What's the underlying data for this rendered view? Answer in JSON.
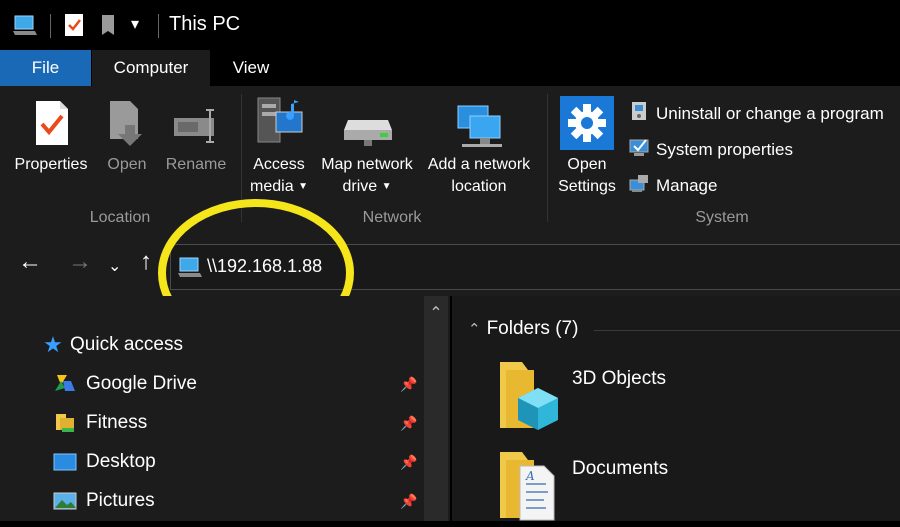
{
  "title_bar": {
    "title": "This PC"
  },
  "tabs": {
    "file": "File",
    "computer": "Computer",
    "view": "View"
  },
  "ribbon": {
    "location": {
      "label": "Location",
      "properties": "Properties",
      "open": "Open",
      "rename": "Rename"
    },
    "network": {
      "label": "Network",
      "access_media_1": "Access",
      "access_media_2": "media",
      "map_drive_1": "Map network",
      "map_drive_2": "drive",
      "add_location_1": "Add a network",
      "add_location_2": "location"
    },
    "system": {
      "label": "System",
      "open_settings_1": "Open",
      "open_settings_2": "Settings",
      "uninstall": "Uninstall or change a program",
      "system_properties": "System properties",
      "manage": "Manage"
    }
  },
  "address_bar": {
    "path": "\\\\192.168.1.88"
  },
  "nav_pane": {
    "items": [
      {
        "label": "Quick access"
      },
      {
        "label": "Google Drive"
      },
      {
        "label": "Fitness"
      },
      {
        "label": "Desktop"
      },
      {
        "label": "Pictures"
      }
    ]
  },
  "content": {
    "folders_header": "Folders (7)",
    "folders": [
      {
        "name": "3D Objects"
      },
      {
        "name": "Documents"
      }
    ]
  },
  "colors": {
    "accent": "#1a69b7",
    "highlight_ellipse": "#f5e51b",
    "ribbon_bg": "#1c1c1c"
  }
}
